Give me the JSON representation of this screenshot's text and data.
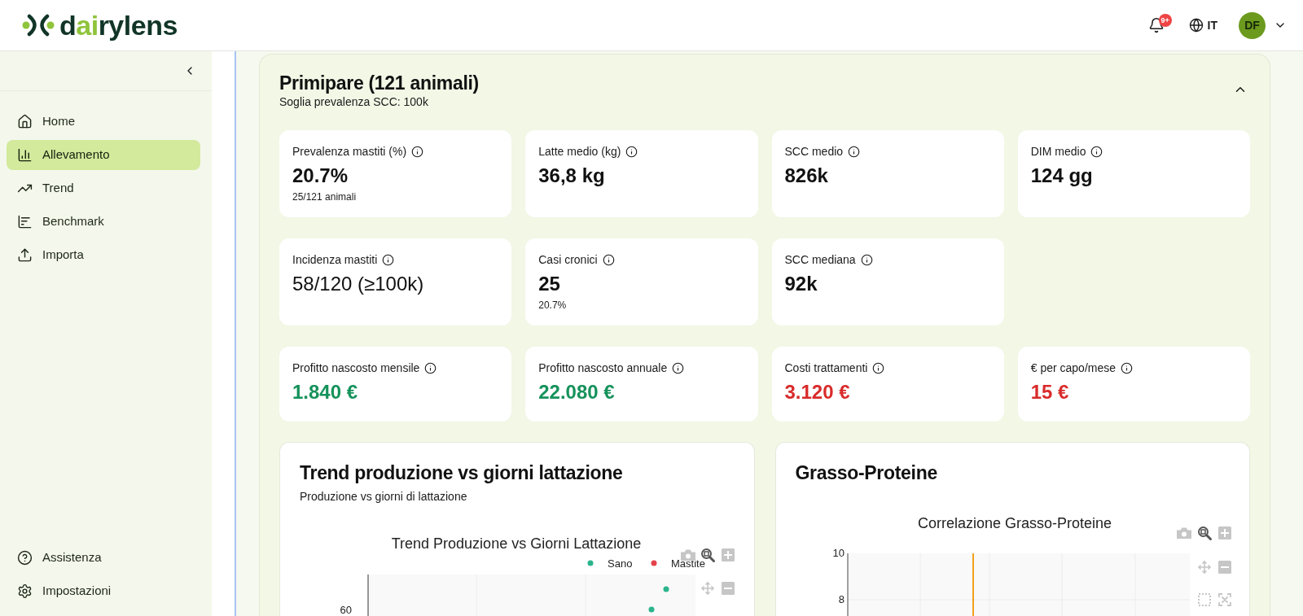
{
  "header": {
    "logo": [
      {
        "text": "d",
        "accent": false
      },
      {
        "text": "ai",
        "accent": true
      },
      {
        "text": "rylens",
        "accent": false
      }
    ],
    "notification_badge": "9+",
    "language": "IT",
    "user_initials": "DF"
  },
  "sidebar": {
    "items": [
      {
        "label": "Home",
        "selected": false
      },
      {
        "label": "Allevamento",
        "selected": true
      },
      {
        "label": "Trend",
        "selected": false
      },
      {
        "label": "Benchmark",
        "selected": false
      },
      {
        "label": "Importa",
        "selected": false
      }
    ],
    "footer_items": [
      {
        "label": "Assistenza",
        "selected": false
      },
      {
        "label": "Impostazioni",
        "selected": false
      }
    ]
  },
  "section": {
    "title": "Primipare (121 animali)",
    "subtitle": "Soglia prevalenza SCC: 100k",
    "expanded": true,
    "metric_rows": [
      [
        {
          "label": "Prevalenza mastiti (%)",
          "value": "20.7%",
          "note": "25/121 animali",
          "bold": true
        },
        {
          "label": "Latte medio (kg)",
          "value": "36,8 kg",
          "bold": true
        },
        {
          "label": "SCC medio",
          "value": "826k",
          "bold": true
        },
        {
          "label": "DIM medio",
          "value": "124 gg",
          "bold": true
        }
      ],
      [
        {
          "label": "Incidenza mastiti",
          "value": "58/120 (≥100k)",
          "bold": false
        },
        {
          "label": "Casi cronici",
          "value": "25",
          "note": "20.7%",
          "bold": true
        },
        {
          "label": "SCC mediana",
          "value": "92k",
          "bold": true
        }
      ],
      [
        {
          "label": "Profitto nascosto mensile",
          "value": "1.840 €",
          "bold": true,
          "color": "#15925b"
        },
        {
          "label": "Profitto nascosto annuale",
          "value": "22.080 €",
          "bold": true,
          "color": "#15925b"
        },
        {
          "label": "Costi trattamenti",
          "value": "3.120 €",
          "bold": true,
          "color": "#d92b2b"
        },
        {
          "label": "€ per capo/mese",
          "value": "15 €",
          "bold": true,
          "color": "#d92b2b"
        }
      ]
    ],
    "charts": [
      {
        "kind": "trend",
        "title": "Trend produzione vs giorni lattazione",
        "subtitle": "Produzione vs giorni di lattazione",
        "plot_title": "Trend Produzione vs Giorni Lattazione",
        "legend": [
          {
            "label": "Sano",
            "color": "#2bb48c"
          },
          {
            "label": "Mastite",
            "color": "#e3434b"
          }
        ],
        "y_tick_labels": [
          "60"
        ]
      },
      {
        "kind": "correlation",
        "title": "Grasso-Proteine",
        "plot_title": "Correlazione Grasso-Proteine",
        "y_tick_labels": [
          "10",
          "8"
        ]
      }
    ]
  }
}
